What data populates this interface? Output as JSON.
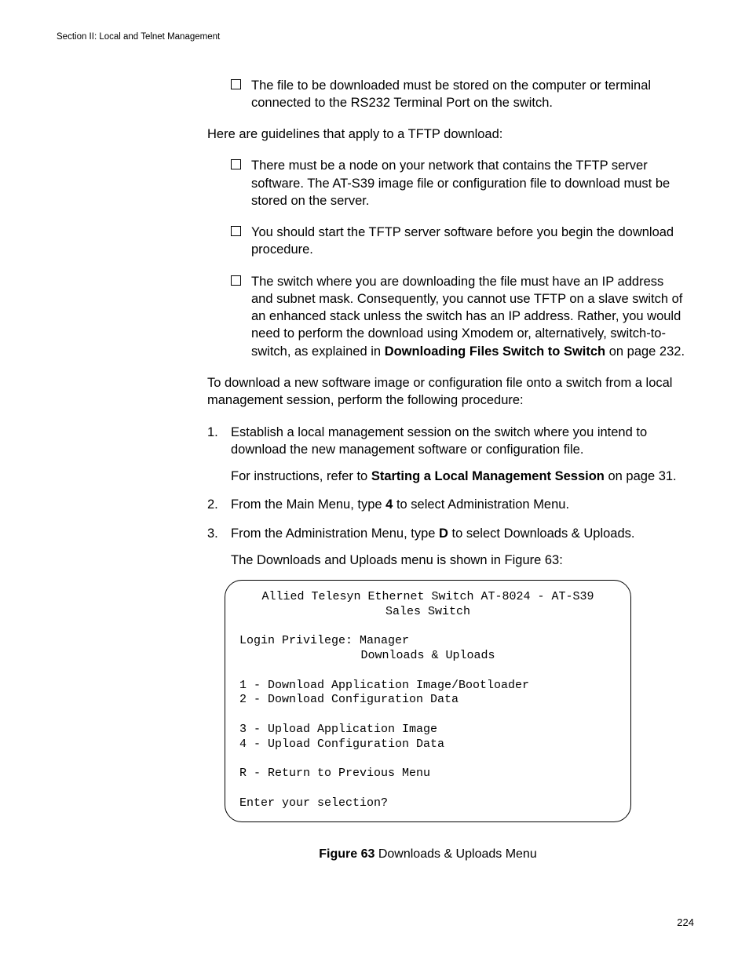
{
  "runningHead": "Section II: Local and Telnet Management",
  "list1": {
    "item1": "The file to be downloaded must be stored on the computer or terminal connected to the RS232 Terminal Port on the switch."
  },
  "para1": "Here are guidelines that apply to a TFTP download:",
  "list2": {
    "item1": "There must be a node on your network that contains the TFTP server software. The AT-S39 image file or configuration file to download must be stored on the server.",
    "item2": "You should start the TFTP server software before you begin the download procedure.",
    "item3_a": "The switch where you are downloading the file must have an IP address and subnet mask. Consequently, you cannot use TFTP on a slave switch of an enhanced stack unless the switch has an IP address. Rather, you would need to perform the download using Xmodem or, alternatively, switch-to-switch, as explained in ",
    "item3_bold": "Downloading Files Switch to Switch",
    "item3_b": " on page 232."
  },
  "para2": "To download a new software image or configuration file onto a switch from a local management session, perform the following procedure:",
  "steps": {
    "n1": "1.",
    "s1": "Establish a local management session on the switch where you intend to download the new management software or configuration file.",
    "s1sub_a": "For instructions, refer to ",
    "s1sub_bold": "Starting a Local Management Session",
    "s1sub_b": " on page 31.",
    "n2": "2.",
    "s2_a": "From the Main Menu, type ",
    "s2_bold": "4",
    "s2_b": " to select Administration Menu.",
    "n3": "3.",
    "s3_a": "From the Administration Menu, type ",
    "s3_bold": "D",
    "s3_b": " to select Downloads & Uploads.",
    "s3sub": "The Downloads and Uploads menu is shown in Figure 63:"
  },
  "terminal": {
    "line1": "Allied Telesyn Ethernet Switch AT-8024 - AT-S39",
    "line2": "Sales Switch",
    "line3": "Login Privilege: Manager",
    "line4": "Downloads & Uploads",
    "line5": "1 - Download Application Image/Bootloader",
    "line6": "2 - Download Configuration Data",
    "line7": "3 - Upload Application Image",
    "line8": "4 - Upload Configuration Data",
    "line9": "R - Return to Previous Menu",
    "line10": "Enter your selection?"
  },
  "figCaptionBold": "Figure 63",
  "figCaptionRest": "  Downloads & Uploads Menu",
  "pageNumber": "224"
}
